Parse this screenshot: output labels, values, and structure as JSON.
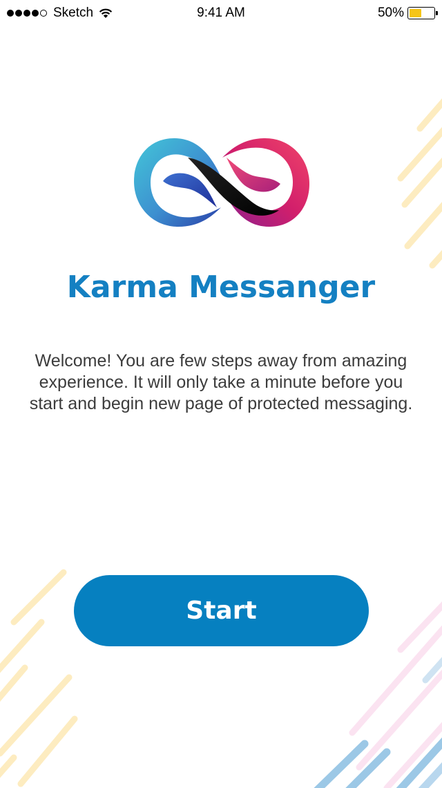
{
  "status_bar": {
    "carrier": "Sketch",
    "time": "9:41 AM",
    "battery_percent": "50%",
    "battery_level": 0.5,
    "signal_bars_filled": 4,
    "signal_bars_total": 5
  },
  "app": {
    "title": "Karma Messanger",
    "welcome": "Welcome! You are few steps away from amazing experience. It will only take a minute before you start and begin new page of protected messaging."
  },
  "actions": {
    "start_label": "Start"
  },
  "colors": {
    "brand_blue": "#0680c0",
    "title_blue": "#1480c2",
    "battery_yellow": "#f5c518",
    "stripe_yellow": "#fde9b8",
    "stripe_blue": "#9cc8e6",
    "stripe_pink": "#fbe0f0"
  },
  "icons": {
    "wifi": "wifi-icon",
    "battery": "battery-icon",
    "logo": "infinity-logo-icon"
  }
}
